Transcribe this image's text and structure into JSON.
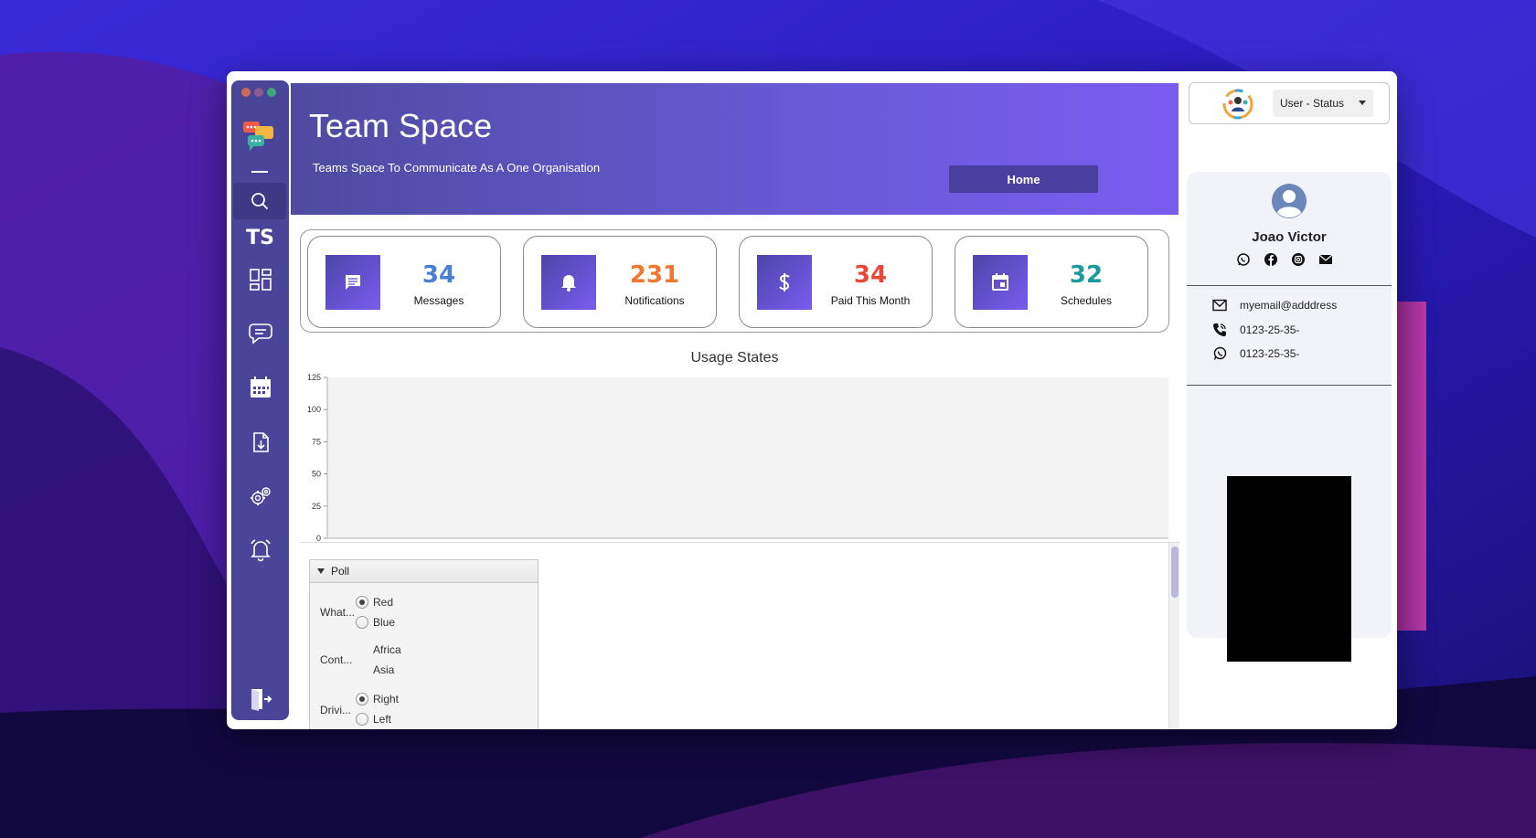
{
  "window": {
    "controls": [
      "close",
      "minimize",
      "maximize"
    ]
  },
  "sidebar": {
    "brand": "TS",
    "items": [
      {
        "name": "search",
        "icon": "search-icon"
      },
      {
        "name": "dashboard",
        "icon": "dashboard-icon"
      },
      {
        "name": "chat",
        "icon": "chat-bubbles-icon"
      },
      {
        "name": "calendar",
        "icon": "calendar-icon"
      },
      {
        "name": "download",
        "icon": "file-download-icon"
      },
      {
        "name": "settings",
        "icon": "gears-icon"
      },
      {
        "name": "alerts",
        "icon": "bell-icon"
      },
      {
        "name": "logout",
        "icon": "logout-icon"
      }
    ]
  },
  "banner": {
    "title": "Team Space",
    "subtitle": "Teams Space To Communicate As A One Organisation",
    "home_label": "Home"
  },
  "stats": [
    {
      "value": "34",
      "label": "Messages",
      "color": "#4a7fd4",
      "icon": "message-icon"
    },
    {
      "value": "231",
      "label": "Notifications",
      "color": "#f07830",
      "icon": "bell-icon"
    },
    {
      "value": "34",
      "label": "Paid This Month",
      "color": "#e8483a",
      "icon": "dollar-icon"
    },
    {
      "value": "32",
      "label": "Schedules",
      "color": "#1a9a9a",
      "icon": "calendar-icon"
    }
  ],
  "chart_data": {
    "type": "bar",
    "title": "Usage States",
    "categories": [],
    "series": [],
    "ylim": [
      0,
      125
    ],
    "yticks": [
      "0",
      "25",
      "50",
      "75",
      "100",
      "125"
    ],
    "grid": false
  },
  "poll": {
    "title": "Poll",
    "questions": [
      {
        "label": "What...",
        "options": [
          {
            "text": "Red",
            "selected": true
          },
          {
            "text": "Blue",
            "selected": false
          }
        ]
      },
      {
        "label": "Cont...",
        "options": [
          {
            "text": "Africa"
          },
          {
            "text": "Asia"
          }
        ]
      },
      {
        "label": "Drivi...",
        "options": [
          {
            "text": "Right",
            "selected": true
          },
          {
            "text": "Left",
            "selected": false
          }
        ]
      }
    ]
  },
  "status": {
    "selected": "User - Status"
  },
  "profile": {
    "name": "Joao Victor",
    "socials": [
      "whatsapp-icon",
      "facebook-icon",
      "instagram-icon",
      "mail-icon"
    ],
    "email": "myemail@adddress",
    "phone": "0123-25-35-",
    "whatsapp": "0123-25-35-"
  }
}
